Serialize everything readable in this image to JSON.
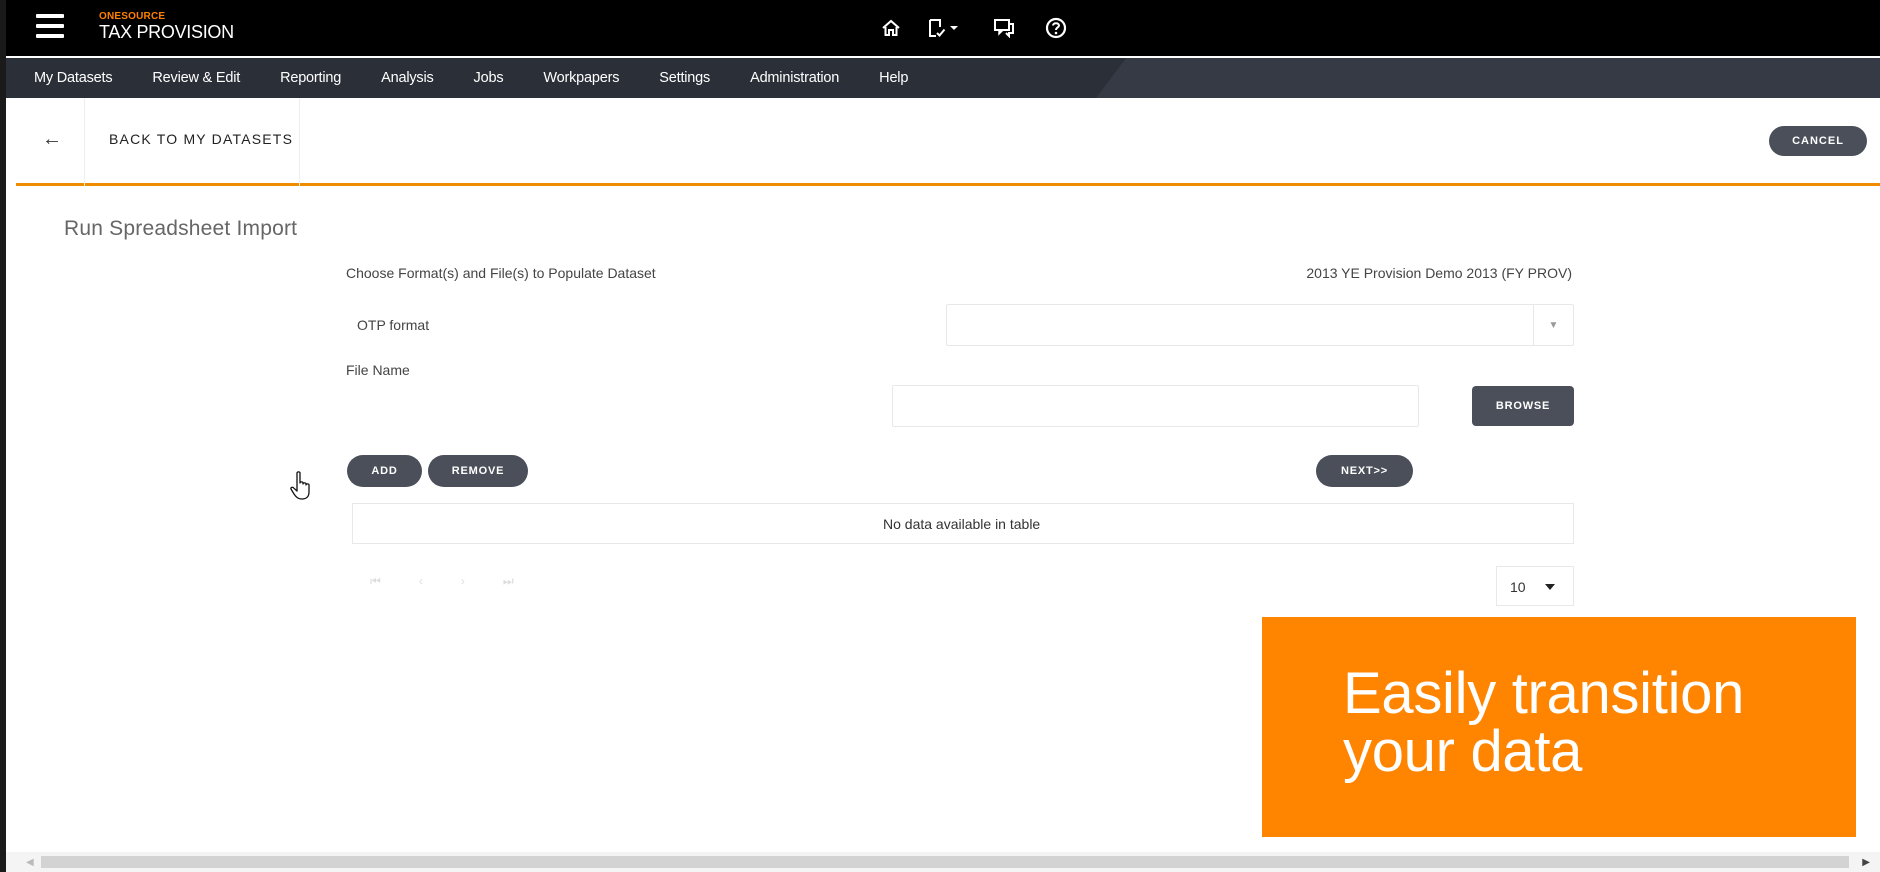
{
  "header": {
    "brand_small": "ONESOURCE",
    "brand_large": "TAX PROVISION",
    "icons": [
      "menu-icon",
      "home-icon",
      "document-check-icon",
      "chevron-down-icon",
      "chat-icon",
      "help-icon"
    ]
  },
  "nav": {
    "items": [
      "My Datasets",
      "Review & Edit",
      "Reporting",
      "Analysis",
      "Jobs",
      "Workpapers",
      "Settings",
      "Administration",
      "Help"
    ]
  },
  "subheader": {
    "back_arrow": "←",
    "back_label": "BACK TO MY DATASETS",
    "cancel_label": "CANCEL"
  },
  "page": {
    "title": "Run Spreadsheet Import",
    "choose_label": "Choose Format(s) and File(s) to Populate Dataset",
    "dataset_name": "2013 YE Provision Demo 2013 (FY PROV)",
    "format_label": "OTP format",
    "format_value": "",
    "file_name_label": "File Name",
    "file_name_value": "",
    "browse_label": "BROWSE",
    "add_label": "ADD",
    "remove_label": "REMOVE",
    "next_label": "NEXT>>",
    "empty_table_text": "No data available in table",
    "pager": [
      "⏮",
      "‹",
      "›",
      "⏭"
    ],
    "page_size": "10"
  },
  "promo": {
    "line1": "Easily transition",
    "line2": "your data"
  },
  "colors": {
    "accent": "#ff8400",
    "topbar": "#000000",
    "navbar": "#2b2f38",
    "button": "#4a4f5a"
  }
}
